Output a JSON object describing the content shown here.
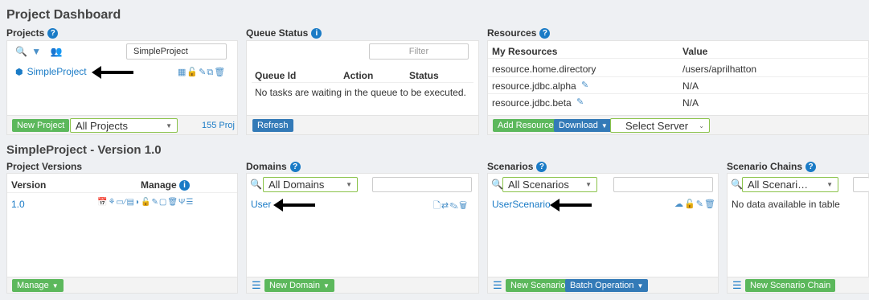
{
  "header": {
    "title": "Project Dashboard",
    "subtitle": "SimpleProject - Version 1.0"
  },
  "projects": {
    "title": "Projects",
    "search_value": "SimpleProject",
    "item": "SimpleProject",
    "new_button": "New Project",
    "filter_select": "All Projects",
    "count": "155 Proj"
  },
  "queue": {
    "title": "Queue Status",
    "filter_placeholder": "Filter",
    "columns": [
      "Queue Id",
      "Action",
      "Status"
    ],
    "empty": "No tasks are waiting in the queue to be executed.",
    "refresh": "Refresh"
  },
  "resources": {
    "title": "Resources",
    "columns": [
      "My Resources",
      "Value"
    ],
    "rows": [
      {
        "name": "resource.home.directory",
        "value": "/users/aprilhatton"
      },
      {
        "name": "resource.jdbc.alpha",
        "value": "N/A"
      },
      {
        "name": "resource.jdbc.beta",
        "value": "N/A"
      }
    ],
    "add_button": "Add Resource",
    "download_button": "Download",
    "server_select": "Select Server"
  },
  "versions": {
    "title": "Project Versions",
    "columns": [
      "Version",
      "Manage"
    ],
    "row": "1.0",
    "manage_button": "Manage"
  },
  "domains": {
    "title": "Domains",
    "select": "All Domains",
    "item": "User",
    "new_button": "New Domain"
  },
  "scenarios": {
    "title": "Scenarios",
    "select": "All Scenarios",
    "item": "UserScenario",
    "new_button": "New Scenario",
    "batch_button": "Batch Operation"
  },
  "chains": {
    "title": "Scenario Chains",
    "select": "All Scenari…",
    "empty": "No data available in table",
    "new_button": "New Scenario Chain"
  }
}
